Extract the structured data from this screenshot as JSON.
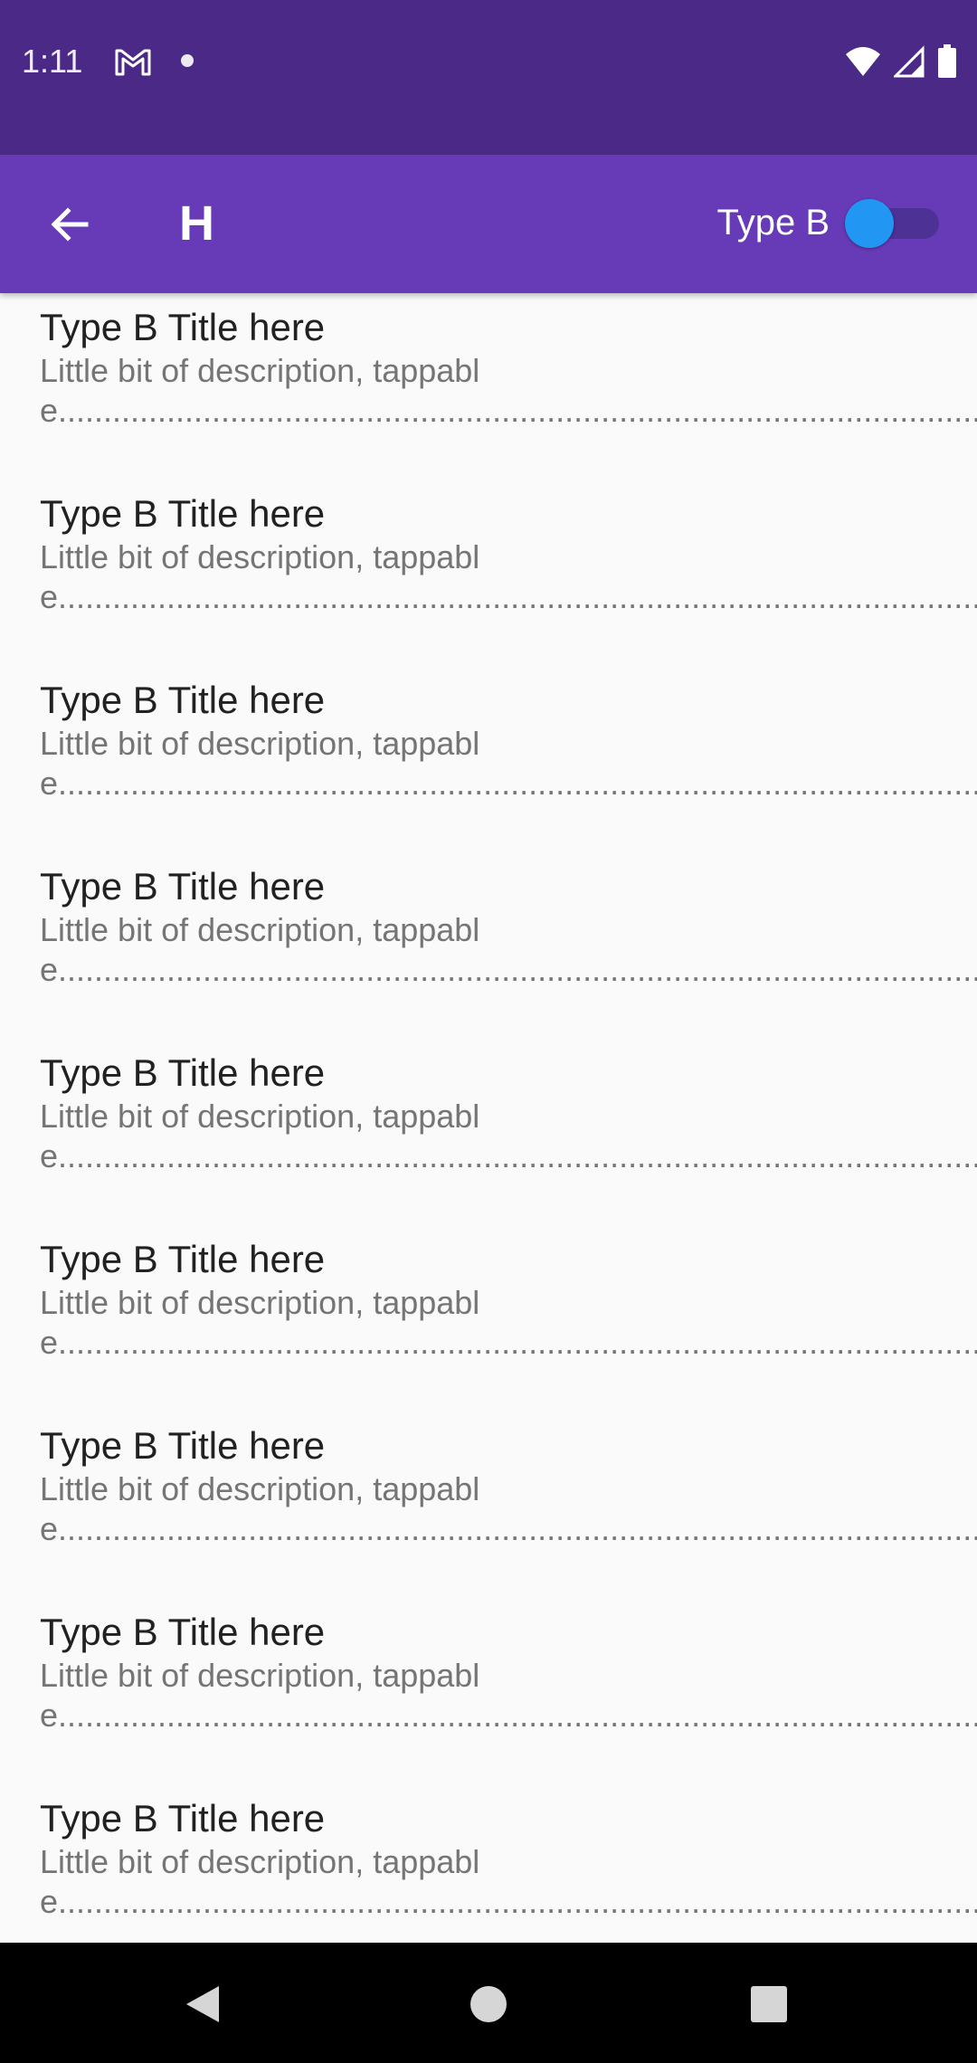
{
  "status_bar": {
    "time": "1:11",
    "icons": [
      "gmail-icon",
      "notification-dot-icon",
      "wifi-icon",
      "cellular-signal-icon",
      "battery-icon"
    ]
  },
  "app_bar": {
    "title": "H",
    "toggle_label": "Type B",
    "toggle_on": true,
    "back_icon": "arrow-left-icon"
  },
  "colors": {
    "status_bar": "#4b2a87",
    "app_bar": "#673ab7",
    "switch_thumb": "#2196f3",
    "switch_track": "#4d3195",
    "background": "#fafafa",
    "title_text": "#212121",
    "description_text": "#757575"
  },
  "list": {
    "items": [
      {
        "title": "Type B Title here",
        "description": "Little bit of description, tappable.................................................................................................................."
      },
      {
        "title": "Type B Title here",
        "description": "Little bit of description, tappable.................................................................................................................."
      },
      {
        "title": "Type B Title here",
        "description": "Little bit of description, tappable.................................................................................................................."
      },
      {
        "title": "Type B Title here",
        "description": "Little bit of description, tappable.................................................................................................................."
      },
      {
        "title": "Type B Title here",
        "description": "Little bit of description, tappable.................................................................................................................."
      },
      {
        "title": "Type B Title here",
        "description": "Little bit of description, tappable.................................................................................................................."
      },
      {
        "title": "Type B Title here",
        "description": "Little bit of description, tappable.................................................................................................................."
      },
      {
        "title": "Type B Title here",
        "description": "Little bit of description, tappable.................................................................................................................."
      },
      {
        "title": "Type B Title here",
        "description": "Little bit of description, tappable.................................................................................................................."
      }
    ]
  },
  "nav_bar": {
    "buttons": [
      "back-triangle-icon",
      "home-circle-icon",
      "recents-square-icon"
    ]
  }
}
